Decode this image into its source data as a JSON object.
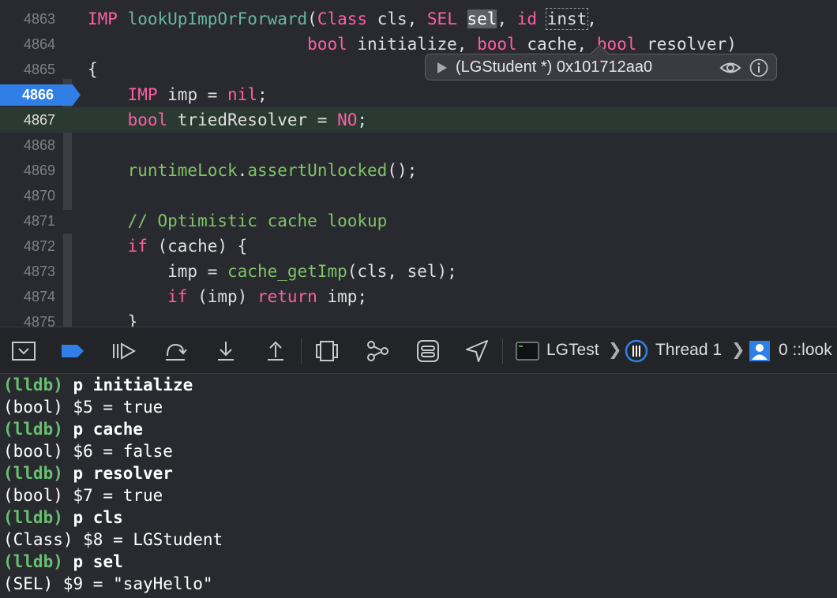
{
  "editor": {
    "lines": [
      {
        "num": "4863",
        "segs": [
          {
            "t": "IMP",
            "c": "kw"
          },
          {
            "t": " "
          },
          {
            "t": "lookUpImpOrForward",
            "c": "fn"
          },
          {
            "t": "("
          },
          {
            "t": "Class",
            "c": "kw"
          },
          {
            "t": " cls, "
          },
          {
            "t": "SEL",
            "c": "kw"
          },
          {
            "t": " "
          },
          {
            "t": "sel",
            "c": "sel-hl"
          },
          {
            "t": ", "
          },
          {
            "t": "id",
            "c": "kw"
          },
          {
            "t": " "
          },
          {
            "t": "inst",
            "c": "dash"
          },
          {
            "t": ","
          }
        ]
      },
      {
        "num": "4864",
        "segs": [
          {
            "t": "                      "
          },
          {
            "t": "bool",
            "c": "kw"
          },
          {
            "t": " initialize, "
          },
          {
            "t": "bool",
            "c": "kw"
          },
          {
            "t": " cache, "
          },
          {
            "t": "bool",
            "c": "kw"
          },
          {
            "t": " resolver)"
          }
        ]
      },
      {
        "num": "4865",
        "segs": [
          {
            "t": "{"
          }
        ]
      },
      {
        "num": "4866",
        "segs": [
          {
            "t": "    "
          },
          {
            "t": "IMP",
            "c": "kw"
          },
          {
            "t": " imp = "
          },
          {
            "t": "nil",
            "c": "kw"
          },
          {
            "t": ";"
          }
        ]
      },
      {
        "num": "4867",
        "segs": [
          {
            "t": "    "
          },
          {
            "t": "bool",
            "c": "kw"
          },
          {
            "t": " triedResolver = "
          },
          {
            "t": "NO",
            "c": "kw"
          },
          {
            "t": ";"
          }
        ]
      },
      {
        "num": "4868",
        "segs": []
      },
      {
        "num": "4869",
        "segs": [
          {
            "t": "    "
          },
          {
            "t": "runtimeLock",
            "c": "cm2"
          },
          {
            "t": "."
          },
          {
            "t": "assertUnlocked",
            "c": "cm2"
          },
          {
            "t": "();"
          }
        ]
      },
      {
        "num": "4870",
        "segs": []
      },
      {
        "num": "4871",
        "segs": [
          {
            "t": "    "
          },
          {
            "t": "// Optimistic cache lookup",
            "c": "cm2"
          }
        ]
      },
      {
        "num": "4872",
        "segs": [
          {
            "t": "    "
          },
          {
            "t": "if",
            "c": "kw"
          },
          {
            "t": " (cache) {"
          }
        ]
      },
      {
        "num": "4873",
        "segs": [
          {
            "t": "        imp = "
          },
          {
            "t": "cache_getImp",
            "c": "cm2"
          },
          {
            "t": "(cls, sel);"
          }
        ]
      },
      {
        "num": "4874",
        "segs": [
          {
            "t": "        "
          },
          {
            "t": "if",
            "c": "kw"
          },
          {
            "t": " (imp) "
          },
          {
            "t": "return",
            "c": "kw"
          },
          {
            "t": " imp;"
          }
        ]
      },
      {
        "num": "4875",
        "segs": [
          {
            "t": "    }"
          }
        ]
      }
    ],
    "breakpoint_line": "4866",
    "current_line": "4867"
  },
  "popover": {
    "value": "(LGStudent *) 0x101712aa0"
  },
  "debugbar": {
    "target": "LGTest",
    "thread": "Thread 1",
    "frame": "0 ::look"
  },
  "console": {
    "lines": [
      {
        "prompt": "(lldb)",
        "text": "p initialize"
      },
      {
        "text": "(bool) $5 = true"
      },
      {
        "prompt": "(lldb)",
        "text": "p cache"
      },
      {
        "text": "(bool) $6 = false"
      },
      {
        "prompt": "(lldb)",
        "text": "p resolver"
      },
      {
        "text": "(bool) $7 = true"
      },
      {
        "prompt": "(lldb)",
        "text": "p cls"
      },
      {
        "text": "(Class) $8 = LGStudent"
      },
      {
        "prompt": "(lldb)",
        "text": "p sel"
      },
      {
        "text": "(SEL) $9 = \"sayHello\""
      }
    ]
  },
  "colors": {
    "background": "#292a30",
    "keyword": "#fc5fa3",
    "function": "#67b7a4",
    "breakpoint": "#2f7fe6",
    "prompt": "#67c16f"
  }
}
